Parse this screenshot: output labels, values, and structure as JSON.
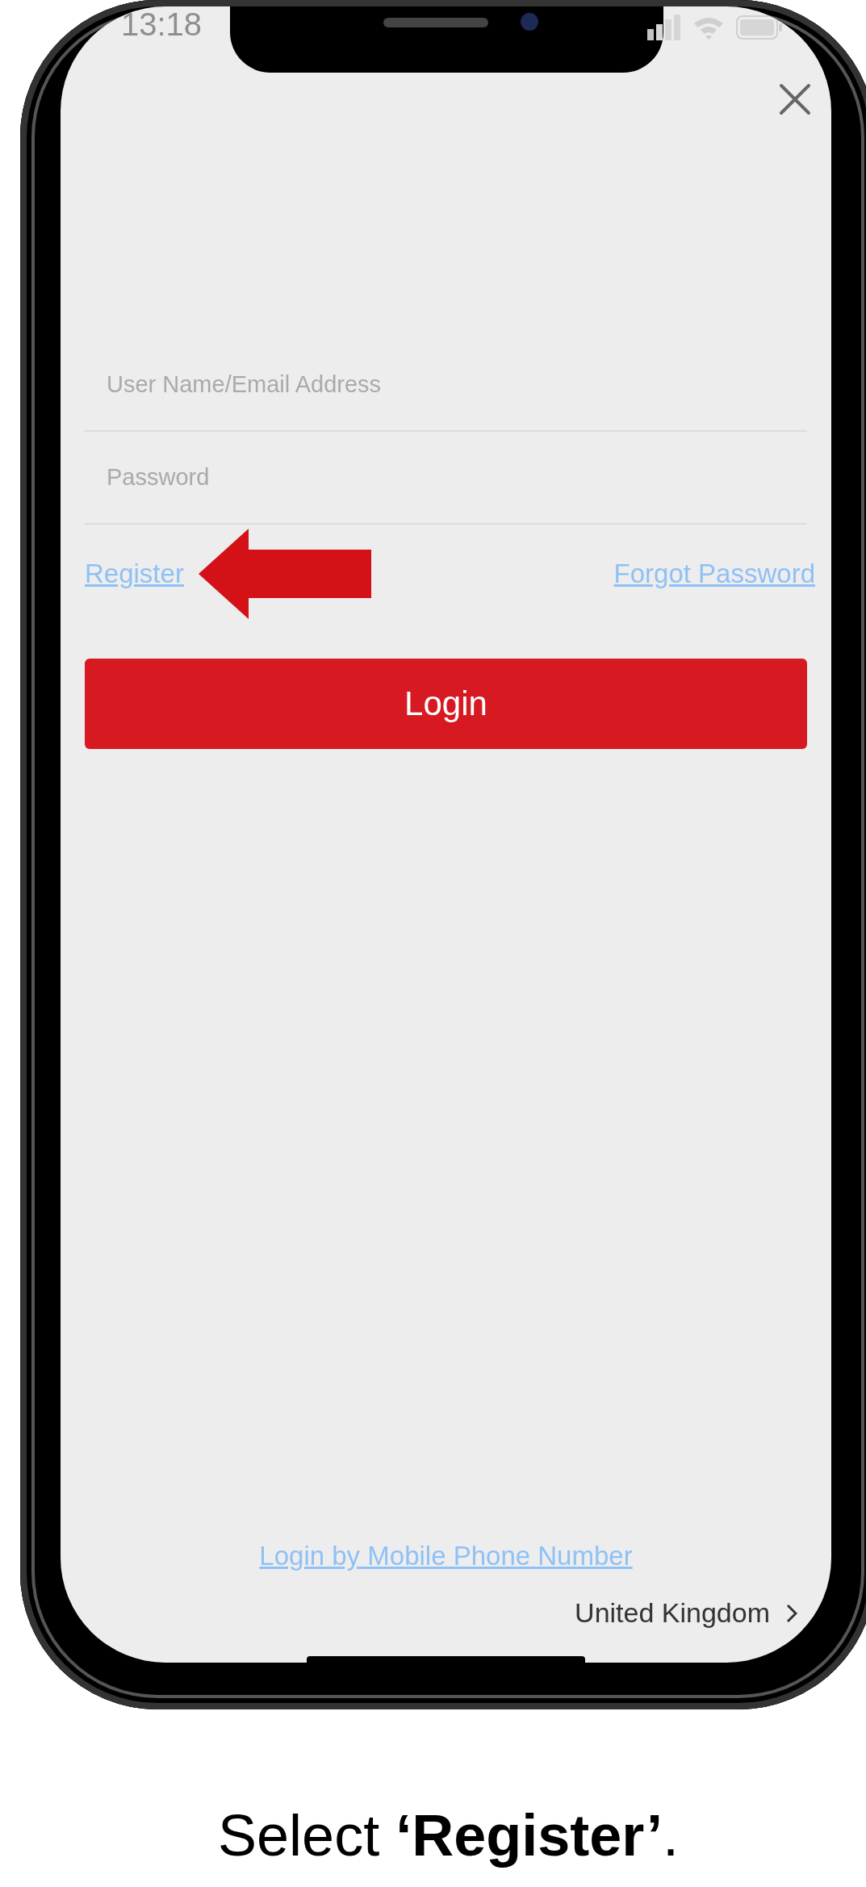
{
  "status_bar": {
    "time": "13:18"
  },
  "login_form": {
    "username_field": {
      "placeholder": "User Name/Email Address"
    },
    "password_field": {
      "placeholder": "Password"
    },
    "register_link": "Register",
    "forgot_password_link": "Forgot Password",
    "login_button": "Login"
  },
  "footer": {
    "mobile_login_link": "Login by Mobile Phone Number",
    "region": "United Kingdom"
  },
  "caption": "Select **‘Register’**."
}
